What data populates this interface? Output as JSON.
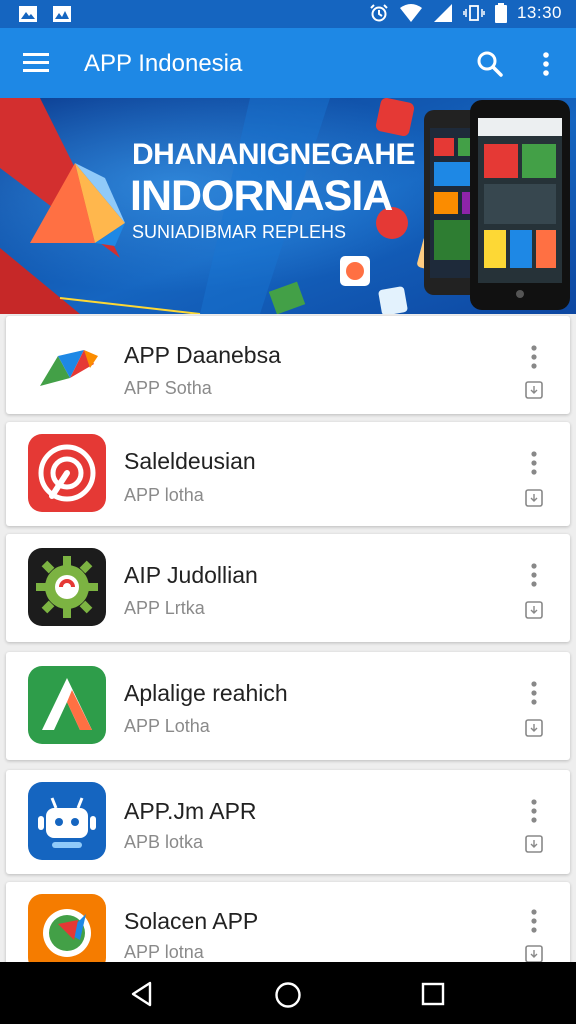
{
  "status_bar": {
    "time": "13:30",
    "left_icons": [
      "gallery-icon",
      "photos-icon"
    ],
    "right_icons": [
      "alarm-icon",
      "wifi-icon",
      "signal-icon",
      "vibrate-icon",
      "battery-icon"
    ]
  },
  "app_bar": {
    "title": "APP Indonesia",
    "icons": [
      "menu-icon",
      "search-icon",
      "more-vert-icon"
    ]
  },
  "banner": {
    "line1": "DHANANIGNEGAHE",
    "line2": "INDORNASIA",
    "line3": "SUNIADIBMAR REPLEHS"
  },
  "apps": [
    {
      "name": "APP Daanebsa",
      "subtitle": "APP Sotha",
      "icon": "colorful-arrow-logo-icon",
      "accent": "#e53935"
    },
    {
      "name": "Saleldeusian",
      "subtitle": "APP lotha",
      "icon": "red-target-icon",
      "accent": "#e53935"
    },
    {
      "name": "AIP Judollian",
      "subtitle": "APP Lrtka",
      "icon": "green-gear-icon",
      "accent": "#7cb342"
    },
    {
      "name": "Aplalige reahich",
      "subtitle": "APP Lotha",
      "icon": "green-letter-a-icon",
      "accent": "#2e9d4a"
    },
    {
      "name": "APP.Jm APR",
      "subtitle": "APB lotka",
      "icon": "blue-robot-icon",
      "accent": "#1565c0"
    },
    {
      "name": "Solacen APP",
      "subtitle": "APP lotna",
      "icon": "orange-compass-icon",
      "accent": "#f57c00"
    }
  ],
  "nav_bar": {
    "icons": [
      "back-icon",
      "home-icon",
      "recent-apps-icon"
    ]
  }
}
